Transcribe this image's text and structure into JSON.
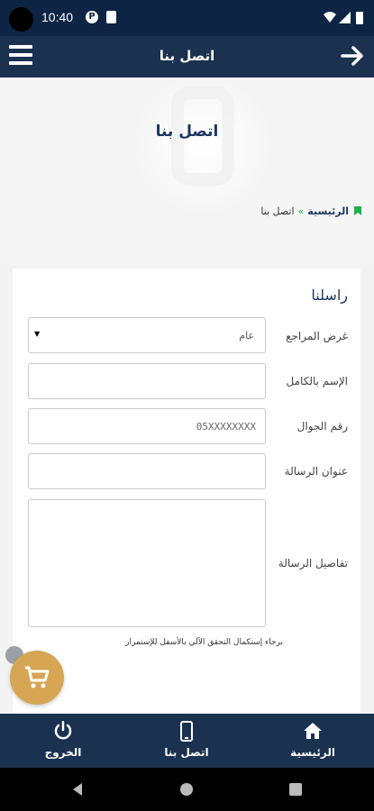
{
  "status_bar": {
    "time": "10:40"
  },
  "app_bar": {
    "title": "اتصل بنا"
  },
  "hero": {
    "heading": "اتصل بنا"
  },
  "breadcrumb": {
    "home": "الرئيسية",
    "separator": "»",
    "current": "اتصل بنا"
  },
  "form": {
    "title": "راسلنا",
    "purpose": {
      "label": "غرض المراجع",
      "value": "عام"
    },
    "full_name": {
      "label": "الإسم بالكامل",
      "value": ""
    },
    "mobile": {
      "label": "رقم الجوال",
      "placeholder": "05XXXXXXXX"
    },
    "subject": {
      "label": "عنوان الرسالة",
      "value": ""
    },
    "details": {
      "label": "تفاصيل الرسالة",
      "value": ""
    },
    "captcha_note": "برجاء إستكمال التحقق الآلي بالأسفل للإستمرار"
  },
  "bottom_nav": {
    "home": "الرئيسية",
    "contact": "اتصل بنا",
    "logout": "الخروج"
  },
  "colors": {
    "navy": "#1a3150",
    "accent_green": "#1bb24a",
    "cart": "#d6a654"
  }
}
